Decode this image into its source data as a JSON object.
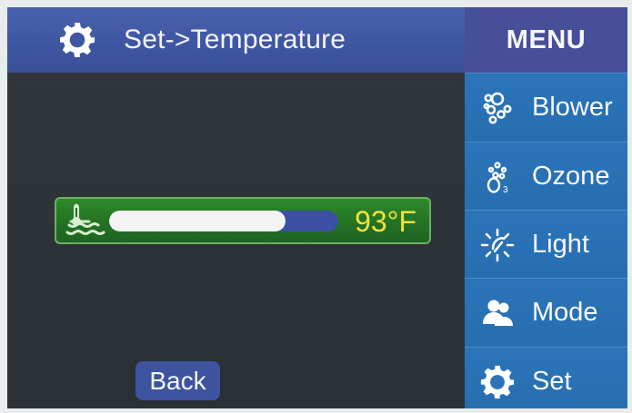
{
  "header": {
    "title": "Set->Temperature"
  },
  "menu": {
    "title": "MENU",
    "items": [
      {
        "label": "Blower",
        "icon": "blower-bubbles-icon"
      },
      {
        "label": "Ozone",
        "icon": "ozone-icon"
      },
      {
        "label": "Light",
        "icon": "light-icon"
      },
      {
        "label": "Mode",
        "icon": "mode-people-icon"
      },
      {
        "label": "Set",
        "icon": "gear-icon"
      }
    ]
  },
  "temperature": {
    "value_label": "93°F",
    "level_fraction": 0.77
  },
  "actions": {
    "back_label": "Back"
  },
  "colors": {
    "header_blue": "#3f57a2",
    "menu_blue": "#2b74b8",
    "temp_green": "#237024",
    "temp_text_yellow": "#f0e23a"
  }
}
